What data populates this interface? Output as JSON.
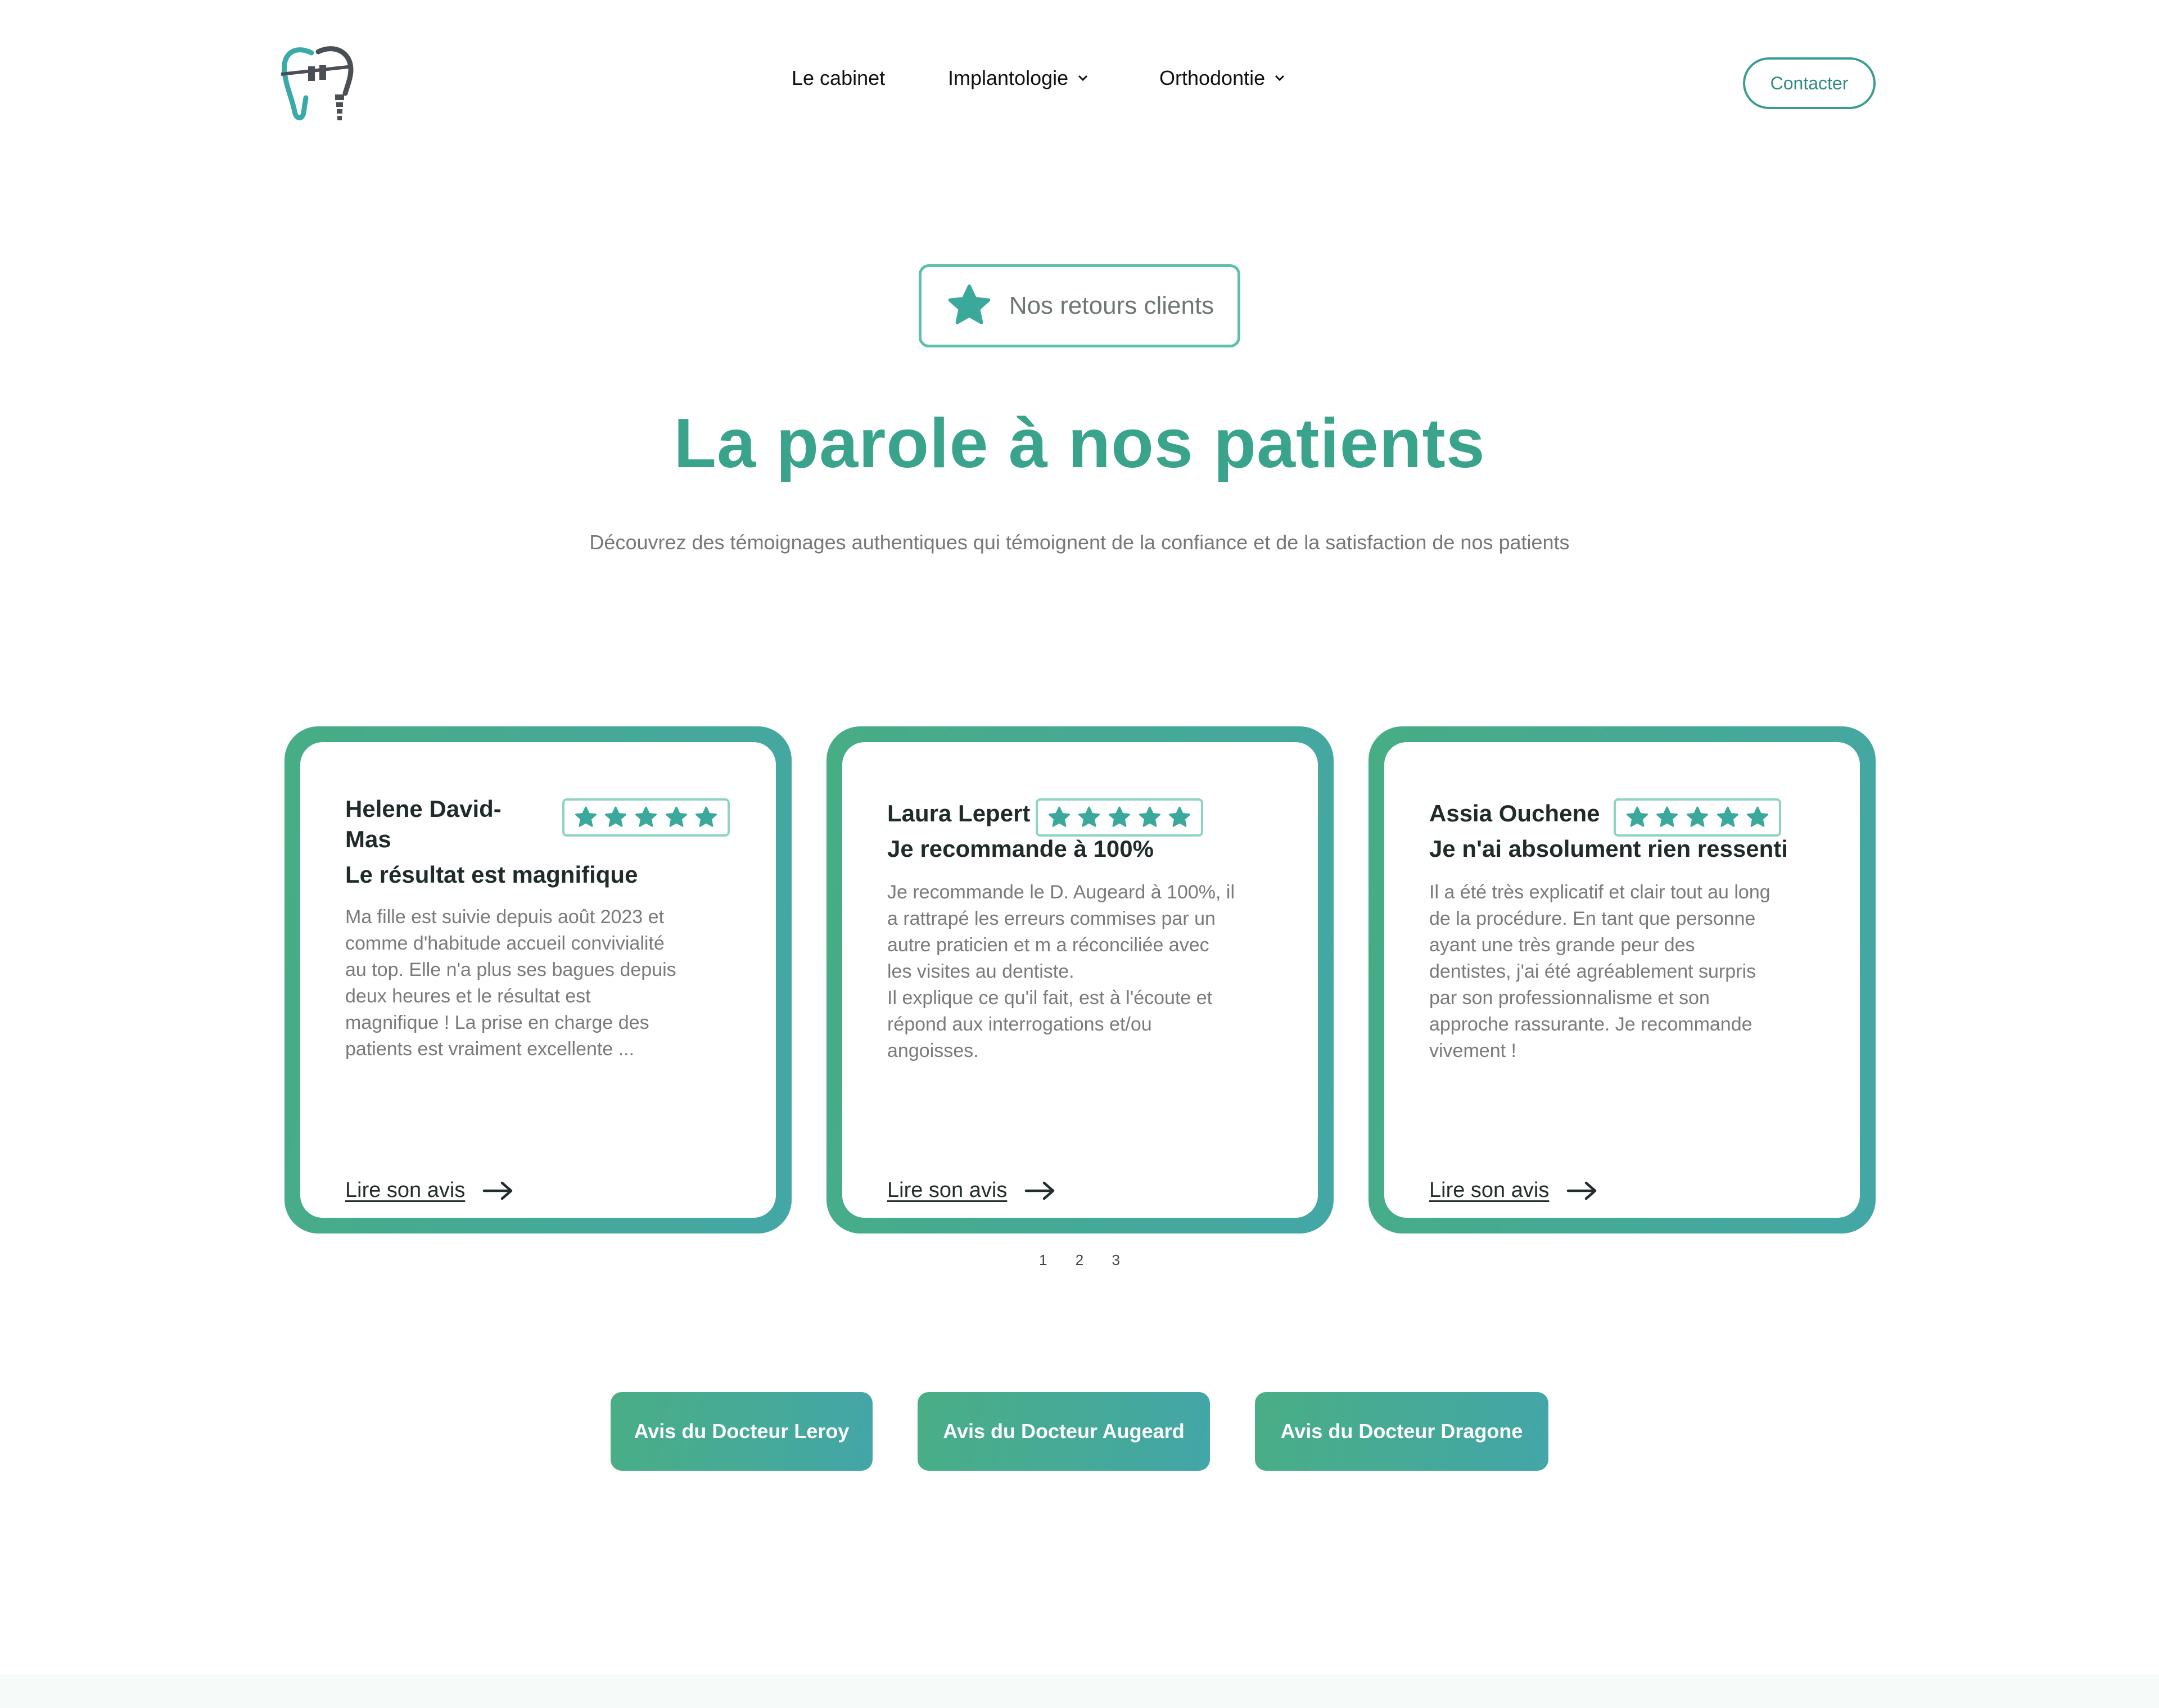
{
  "header": {
    "logo_name": "tooth-logo",
    "nav": [
      {
        "label": "Le cabinet",
        "has_dropdown": false
      },
      {
        "label": "Implantologie",
        "has_dropdown": true
      },
      {
        "label": "Orthodontie",
        "has_dropdown": true
      }
    ],
    "contact_label": "Contacter"
  },
  "hero": {
    "badge_label": "Nos retours clients",
    "title": "La parole à nos patients",
    "subtitle": "Découvrez des témoignages authentiques qui témoignent de la confiance et de la satisfaction de nos patients"
  },
  "reviews": [
    {
      "name": "Helene David-\nMas",
      "rating": 5,
      "title": "Le résultat est magnifique",
      "text": "Ma fille est suivie depuis août 2023 et\ncomme d'habitude accueil convivialité\nau top. Elle n'a plus ses bagues depuis\ndeux heures et le résultat est\nmagnifique ! La prise en charge des\npatients est vraiment excellente ...",
      "link_label": "Lire son avis"
    },
    {
      "name": "Laura Lepert",
      "rating": 5,
      "title": "Je recommande à 100%",
      "text": "Je recommande le D. Augeard à 100%, il\na rattrapé les erreurs commises par un\nautre praticien et m a réconciliée avec\nles visites au dentiste.\nIl explique ce qu'il fait, est à l'écoute et\nrépond aux interrogations et/ou\nangoisses.",
      "link_label": "Lire son avis"
    },
    {
      "name": "Assia Ouchene",
      "rating": 5,
      "title": "Je n'ai absolument rien ressenti",
      "text": "Il a été très explicatif et clair tout au long\nde la procédure. En tant que personne\nayant une très grande peur des\ndentistes, j'ai été agréablement surpris\npar son professionnalisme et son\napproche rassurante. Je recommande\nvivement !",
      "link_label": "Lire son avis"
    }
  ],
  "pager": [
    "1",
    "2",
    "3"
  ],
  "doctor_buttons": [
    "Avis du Docteur Leroy",
    "Avis du Docteur Augeard",
    "Avis du Docteur Dragone"
  ],
  "colors": {
    "accent": "#3aa38c",
    "accent_blue": "#43a7a6",
    "star": "#3aa89a"
  }
}
